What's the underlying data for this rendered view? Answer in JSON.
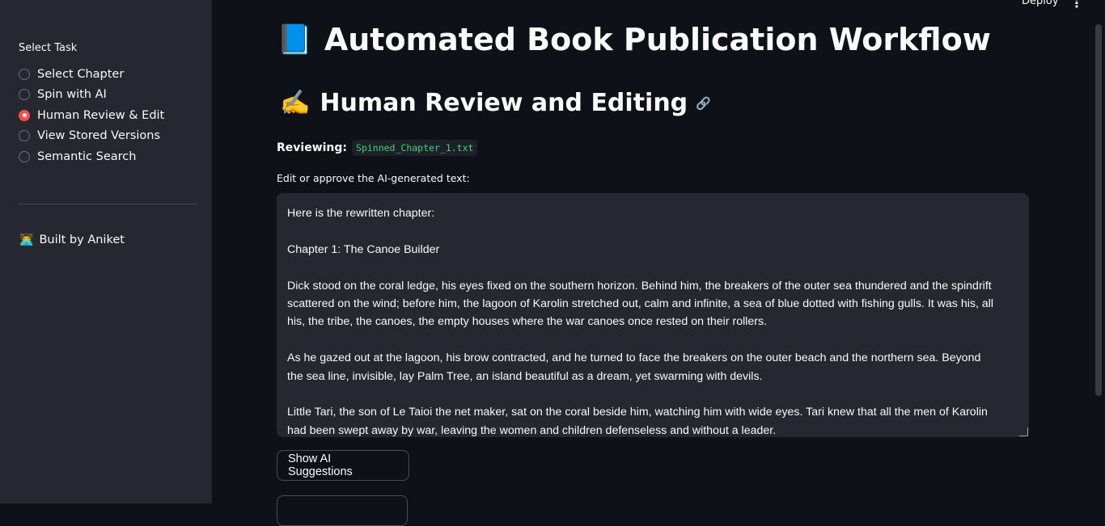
{
  "header": {
    "deploy_label": "Deploy",
    "menu_icon": "⋮"
  },
  "sidebar": {
    "task_label": "Select Task",
    "options": [
      {
        "label": "Select Chapter",
        "selected": false
      },
      {
        "label": "Spin with AI",
        "selected": false
      },
      {
        "label": "Human Review & Edit",
        "selected": true
      },
      {
        "label": "View Stored Versions",
        "selected": false
      },
      {
        "label": "Semantic Search",
        "selected": false
      }
    ],
    "footer_emoji": "👨‍💻",
    "footer_text": "Built by Aniket"
  },
  "main": {
    "title_emoji": "📘",
    "title": "Automated Book Publication Workflow",
    "section_emoji": "✍️",
    "section_title": "Human Review and Editing",
    "reviewing_label": "Reviewing:",
    "reviewing_file": "Spinned_Chapter_1.txt",
    "edit_label": "Edit or approve the AI-generated text:",
    "text": "Here is the rewritten chapter:\n\nChapter 1: The Canoe Builder\n\nDick stood on the coral ledge, his eyes fixed on the southern horizon. Behind him, the breakers of the outer sea thundered and the spindrift scattered on the wind; before him, the lagoon of Karolin stretched out, calm and infinite, a sea of blue dotted with fishing gulls. It was his, all his, the tribe, the canoes, the empty houses where the war canoes once rested on their rollers.\n\nAs he gazed out at the lagoon, his brow contracted, and he turned to face the breakers on the outer beach and the northern sea. Beyond the sea line, invisible, lay Palm Tree, an island beautiful as a dream, yet swarming with devils.\n\nLittle Tari, the son of Le Taioi the net maker, sat on the coral beside him, watching him with wide eyes. Tari knew that all the men of Karolin had been swept away by war, leaving the women and children defenseless and without a leader.",
    "show_suggestions_label": "Show AI Suggestions"
  }
}
